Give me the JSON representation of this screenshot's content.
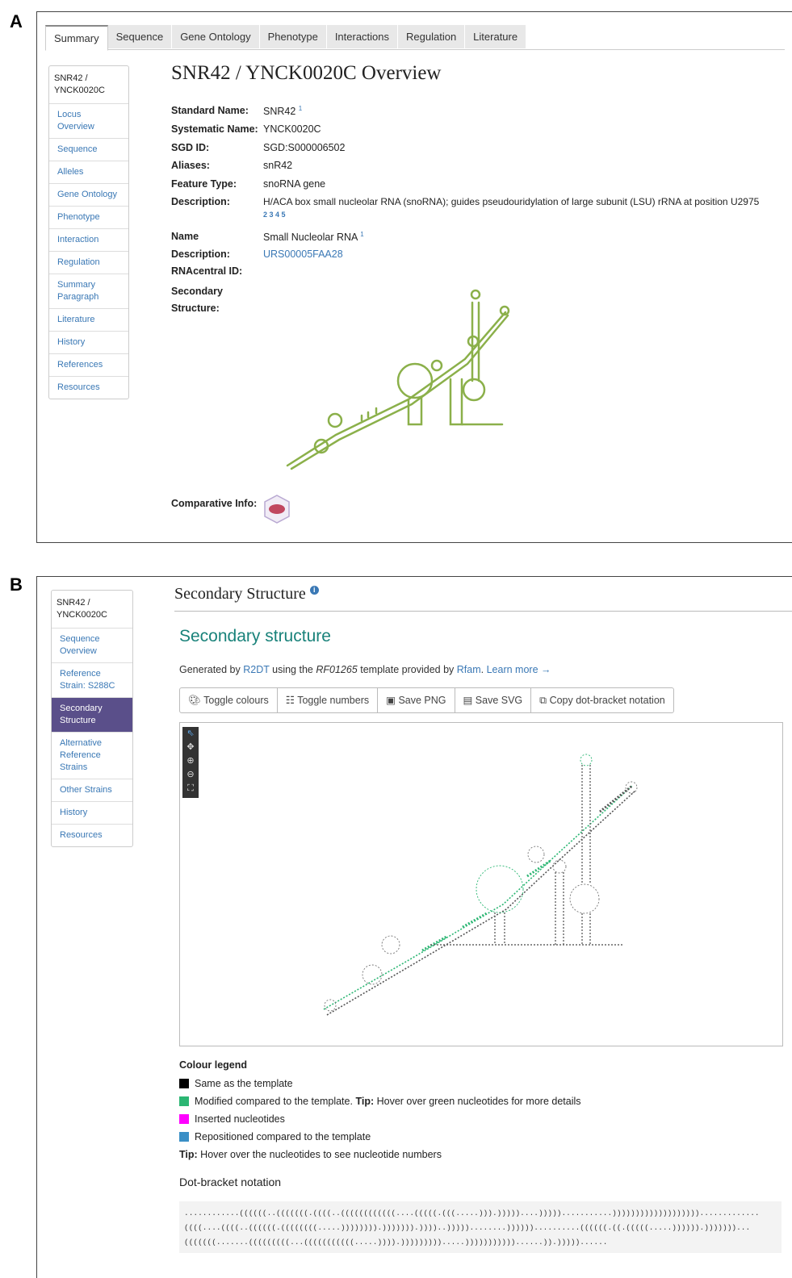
{
  "panel_a_letter": "A",
  "panel_b_letter": "B",
  "panelA": {
    "tabs": [
      "Summary",
      "Sequence",
      "Gene Ontology",
      "Phenotype",
      "Interactions",
      "Regulation",
      "Literature"
    ],
    "sidenav_head": "SNR42 / YNCK0020C",
    "sidenav_items": [
      "Locus Overview",
      "Sequence",
      "Alleles",
      "Gene Ontology",
      "Phenotype",
      "Interaction",
      "Regulation",
      "Summary Paragraph",
      "Literature",
      "History",
      "References",
      "Resources"
    ],
    "title": "SNR42 / YNCK0020C Overview",
    "fields": {
      "standard_name_label": "Standard Name:",
      "standard_name": "SNR42",
      "standard_name_ref": "1",
      "systematic_name_label": "Systematic Name:",
      "systematic_name": "YNCK0020C",
      "sgd_id_label": "SGD ID:",
      "sgd_id": "SGD:S000006502",
      "aliases_label": "Aliases:",
      "aliases": "snR42",
      "feature_type_label": "Feature Type:",
      "feature_type": "snoRNA gene",
      "description_label": "Description:",
      "description": "H/ACA box small nucleolar RNA (snoRNA); guides pseudouridylation of large subunit (LSU) rRNA at position U2975",
      "description_refs": "2 3 4 5",
      "name_label": "Name",
      "name": "Small Nucleolar RNA",
      "name_ref": "1",
      "desc2_label": "Description:",
      "desc2": "URS00005FAA28",
      "rnacentral_label": "RNAcentral ID:",
      "secondary_label": "Secondary Structure:",
      "comparative_label": "Comparative Info:"
    },
    "structure_color": "#8bb04a"
  },
  "panelB": {
    "sidenav_head": "SNR42 / YNCK0020C",
    "sidenav_items": [
      "Sequence Overview",
      "Reference Strain: S288C",
      "Secondary Structure",
      "Alternative Reference Strains",
      "Other Strains",
      "History",
      "Resources"
    ],
    "active_item": "Secondary Structure",
    "section_title": "Secondary Structure",
    "heading": "Secondary structure",
    "generated": {
      "pre": "Generated by ",
      "r2dt": "R2DT",
      "mid": " using the ",
      "template": "RF01265",
      "mid2": " template provided by ",
      "rfam": "Rfam",
      "post": ". ",
      "learn": "Learn more →"
    },
    "toolbar": [
      "Toggle colours",
      "Toggle numbers",
      "Save PNG",
      "Save SVG",
      "Copy dot-bracket notation"
    ],
    "legend": {
      "title": "Colour legend",
      "items": [
        {
          "color": "#000000",
          "label": "Same as the template"
        },
        {
          "color": "#2bb673",
          "label": "Modified compared to the template.",
          "tip_label": "Tip:",
          "tip": "Hover over green nucleotides for more details"
        },
        {
          "color": "#ff00ff",
          "label": "Inserted nucleotides"
        },
        {
          "color": "#3a8fc6",
          "label": "Repositioned compared to the template"
        }
      ],
      "tip_label": "Tip:",
      "tip": "Hover over the nucleotides to see nucleotide numbers"
    },
    "dot_bracket_title": "Dot-bracket notation",
    "dot_bracket": [
      "............((((((..(((((((.((((..((((((((((((....(((((.(((.....))).)))))....)))))...........))))))))))))))))))).............",
      "((((....((((..((((((.((((((((.....)))))))).))))))).))))..)))))........))))))..........((((((.((.(((((.....)))))).)))))))...",
      "(((((((.......(((((((((...(((((((((((.....)))).))))))))).....)))))))))))......)).)))))......"
    ]
  }
}
